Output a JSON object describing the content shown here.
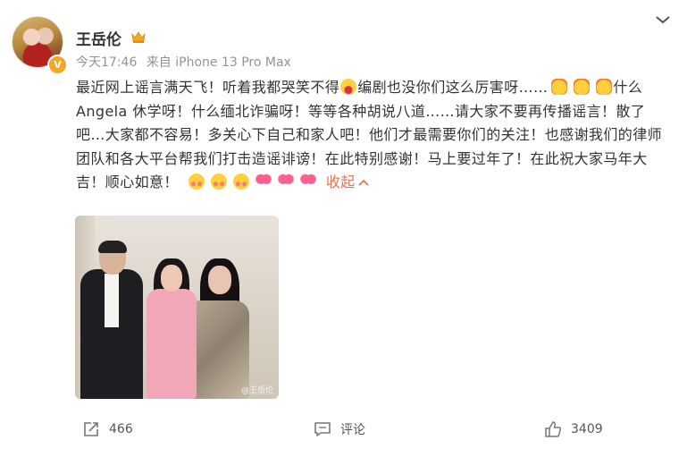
{
  "post": {
    "author": "王岳伦",
    "verified_mark": "V",
    "time": "今天17:46",
    "source": "来自 iPhone 13 Pro Max",
    "text_segments": [
      "最近网上谣言满天飞！听着我都哭笑不得",
      "编剧也没你们这么厉害呀……",
      "什么Angela 休学呀！什么缅北诈骗呀！等等各种胡说八道……请大家不要再传播谣言！散了吧…大家都不容易！多关心下自己和家人吧！他们才最需要你们的关注！也感谢我们的律师团队和各大平台帮我们打击造谣诽谤！在此特别感谢！马上要过年了！在此祝大家马年大吉！顺心如意！"
    ],
    "collapse_label": "收起",
    "photo_watermark": "@王岳伦"
  },
  "actions": {
    "forward_count": "466",
    "comment_label": "评论",
    "like_count": "3409"
  },
  "colors": {
    "accent": "#eb7350",
    "meta_text": "#939393",
    "verified": "#f5a623"
  },
  "icons": [
    "chevron-down-icon",
    "verified-icon",
    "vip-crown-icon",
    "forward-icon",
    "comment-icon",
    "like-icon"
  ]
}
